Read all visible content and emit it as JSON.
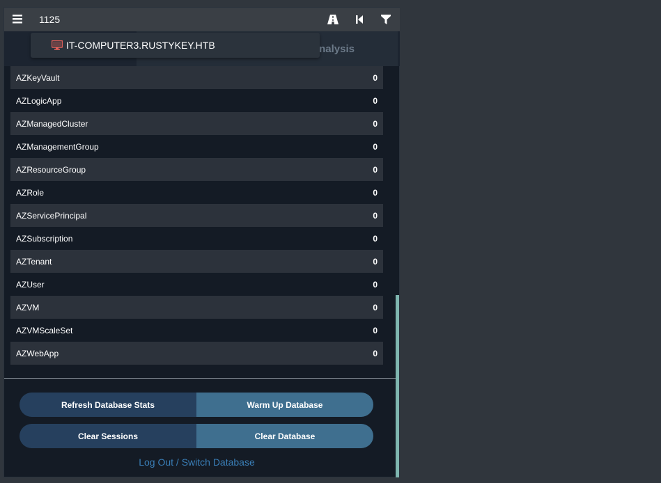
{
  "topbar": {
    "title": "1125",
    "icons": [
      "menu-icon",
      "pathfinding-icon",
      "back-icon",
      "filter-icon"
    ]
  },
  "tabs": {
    "analysis_label": "nalysis"
  },
  "tooltip": {
    "icon": "computer-icon",
    "label": "IT-COMPUTER3.RUSTYKEY.HTB"
  },
  "stats": {
    "rows": [
      {
        "label": "AZKeyVault",
        "value": "0"
      },
      {
        "label": "AZLogicApp",
        "value": "0"
      },
      {
        "label": "AZManagedCluster",
        "value": "0"
      },
      {
        "label": "AZManagementGroup",
        "value": "0"
      },
      {
        "label": "AZResourceGroup",
        "value": "0"
      },
      {
        "label": "AZRole",
        "value": "0"
      },
      {
        "label": "AZServicePrincipal",
        "value": "0"
      },
      {
        "label": "AZSubscription",
        "value": "0"
      },
      {
        "label": "AZTenant",
        "value": "0"
      },
      {
        "label": "AZUser",
        "value": "0"
      },
      {
        "label": "AZVM",
        "value": "0"
      },
      {
        "label": "AZVMScaleSet",
        "value": "0"
      },
      {
        "label": "AZWebApp",
        "value": "0"
      }
    ]
  },
  "buttons": {
    "refresh": "Refresh Database Stats",
    "warmup": "Warm Up Database",
    "clear_sessions": "Clear Sessions",
    "clear_database": "Clear Database",
    "logout": "Log Out / Switch Database"
  },
  "colors": {
    "computer_icon": "#e0605a",
    "link": "#3a7fb8",
    "scrollbar": "#7fb6b0"
  }
}
